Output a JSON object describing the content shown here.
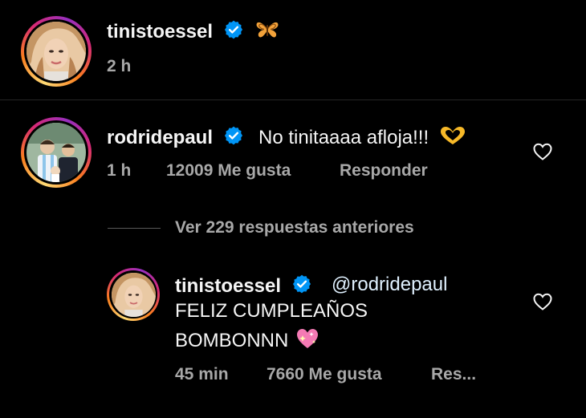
{
  "post": {
    "username": "tinistoessel",
    "time": "2 h"
  },
  "comment": {
    "username": "rodridepaul",
    "text": "No tinitaaaa afloja!!!",
    "time": "1 h",
    "likes": "12009 Me gusta",
    "reply_label": "Responder"
  },
  "view_replies": {
    "label": "Ver 229 respuestas anteriores"
  },
  "reply": {
    "username": "tinistoessel",
    "mention": "@rodridepaul",
    "text_line1": "FELIZ CUMPLEAÑOS",
    "text_line2": "BOMBONNN",
    "time": "45 min",
    "likes": "7660 Me gusta",
    "reply_label": "Res..."
  },
  "icons": {
    "verified": "verified-badge-icon",
    "butterfly": "butterfly-emoji-icon",
    "heart_hands": "heart-hands-emoji-icon",
    "sparkling_heart": "sparkling-heart-emoji-icon",
    "like": "heart-outline-icon"
  },
  "colors": {
    "background": "#000000",
    "text_primary": "#f5f5f5",
    "text_secondary": "#a8a8a8",
    "verified_blue": "#0095f6",
    "divider": "#262626"
  }
}
